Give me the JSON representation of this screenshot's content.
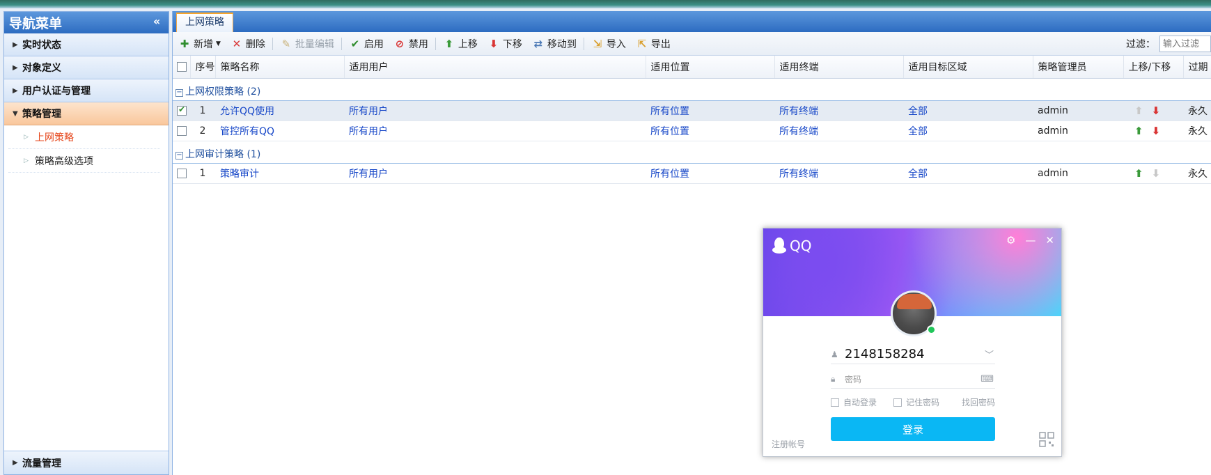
{
  "sidebar": {
    "title": "导航菜单",
    "collapse_icon": "«",
    "groups": [
      {
        "label": "实时状态"
      },
      {
        "label": "对象定义"
      },
      {
        "label": "用户认证与管理"
      },
      {
        "label": "策略管理"
      }
    ],
    "sub_items": [
      {
        "label": "上网策略"
      },
      {
        "label": "策略高级选项"
      }
    ],
    "bottom_group": {
      "label": "流量管理"
    }
  },
  "main": {
    "tab": "上网策略",
    "toolbar": {
      "add": "新增",
      "delete": "删除",
      "batch_edit": "批量编辑",
      "enable": "启用",
      "disable": "禁用",
      "move_up": "上移",
      "move_down": "下移",
      "move_to": "移动到",
      "import": "导入",
      "export": "导出",
      "filter_label": "过滤：",
      "filter_placeholder": "输入过滤"
    },
    "columns": [
      "序号",
      "策略名称",
      "适用用户",
      "适用位置",
      "适用终端",
      "适用目标区域",
      "策略管理员",
      "上移/下移",
      "过期"
    ],
    "groups": [
      {
        "title": "上网权限策略 (2)",
        "rows": [
          {
            "no": "1",
            "name": "允许QQ使用",
            "user": "所有用户",
            "location": "所有位置",
            "terminal": "所有终端",
            "zone": "全部",
            "admin": "admin",
            "expire": "永久"
          },
          {
            "no": "2",
            "name": "管控所有QQ",
            "user": "所有用户",
            "location": "所有位置",
            "terminal": "所有终端",
            "zone": "全部",
            "admin": "admin",
            "expire": "永久"
          }
        ]
      },
      {
        "title": "上网审计策略 (1)",
        "rows": [
          {
            "no": "1",
            "name": "策略审计",
            "user": "所有用户",
            "location": "所有位置",
            "terminal": "所有终端",
            "zone": "全部",
            "admin": "admin",
            "expire": "永久"
          }
        ]
      }
    ]
  },
  "qq": {
    "brand": "QQ",
    "account": "2148158284",
    "password_placeholder": "密码",
    "auto_login": "自动登录",
    "remember_pwd": "记住密码",
    "find_pwd": "找回密码",
    "login_button": "登录",
    "register": "注册帐号"
  },
  "colors": {
    "nav_blue": "#2d6cc1",
    "active_orange": "#f9c79c",
    "link_blue": "#1747c8",
    "qq_button": "#0ab7f4"
  }
}
